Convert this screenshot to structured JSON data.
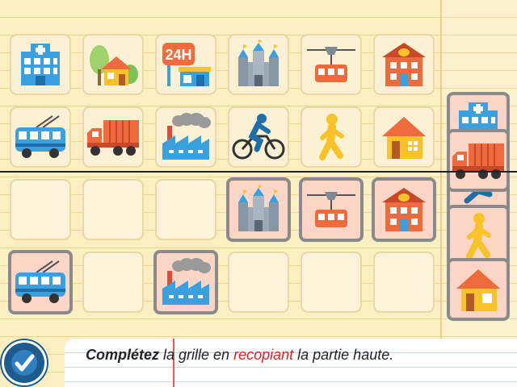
{
  "instruction": {
    "verb": "Complétez",
    "part1": " la grille en ",
    "highlight": "recopiant",
    "part2": " la partie haute."
  },
  "icons": {
    "row1": [
      "hospital-icon",
      "house-with-tree-icon",
      "24h-shop-icon",
      "castle-icon",
      "cable-car-icon",
      "post-office-icon"
    ],
    "row2": [
      "trolleybus-icon",
      "truck-icon",
      "factory-icon",
      "cyclist-icon",
      "pedestrian-icon",
      "house-icon"
    ],
    "row3": [
      "empty",
      "empty",
      "empty",
      "castle-icon",
      "cable-car-icon",
      "post-office-icon"
    ],
    "row4": [
      "trolleybus-icon",
      "empty",
      "factory-icon",
      "empty",
      "empty",
      "empty"
    ],
    "side_pieces": [
      "hospital-icon",
      "truck-icon",
      "cyclist-icon",
      "pedestrian-icon",
      "house-icon"
    ]
  },
  "sign_text": "24H",
  "colors": {
    "accent_blue": "#3aa0e0",
    "accent_orange": "#ef6a3c",
    "accent_yellow": "#f7c328",
    "placed_tile_bg": "#fbd6c6",
    "check_button": "#1d5c8c"
  }
}
